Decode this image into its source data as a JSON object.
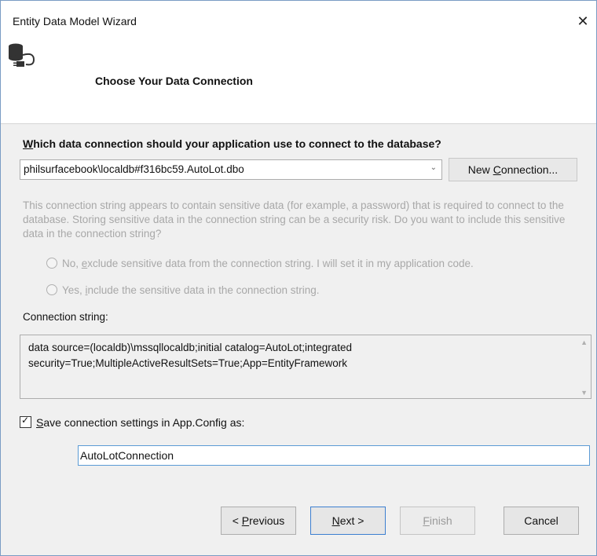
{
  "window": {
    "title": "Entity Data Model Wizard",
    "close_glyph": "✕"
  },
  "header": {
    "heading": "Choose Your Data Connection",
    "icon": "database-connection-icon"
  },
  "question": {
    "prefix": "W",
    "rest": "hich data connection should your application use to connect to the database?"
  },
  "connection": {
    "selected": "philsurfacebook\\localdb#f316bc59.AutoLot.dbo",
    "chevron": "⌄",
    "new_button_prefix": "New ",
    "new_button_access": "C",
    "new_button_rest": "onnection..."
  },
  "sensitive": {
    "description": "This connection string appears to contain sensitive data (for example, a password) that is required to connect to the database. Storing sensitive data in the connection string can be a security risk. Do you want to include this sensitive data in the connection string?",
    "option_no_prefix": "No, ",
    "option_no_access": "e",
    "option_no_rest": "xclude sensitive data from the connection string. I will set it in my application code.",
    "option_yes_prefix": "Yes, ",
    "option_yes_access": "i",
    "option_yes_rest": "nclude the sensitive data in the connection string."
  },
  "connection_string": {
    "label": "Connection string:",
    "value": "data source=(localdb)\\mssqllocaldb;initial catalog=AutoLot;integrated security=True;MultipleActiveResultSets=True;App=EntityFramework",
    "scroll_up": "▲",
    "scroll_down": "▼"
  },
  "save": {
    "checked": true,
    "check_glyph": "✓",
    "label_access": "S",
    "label_rest": "ave connection settings in App.Config as:",
    "config_name": "AutoLotConnection"
  },
  "buttons": {
    "prev_prefix": "< ",
    "prev_access": "P",
    "prev_rest": "revious",
    "next_access": "N",
    "next_rest": "ext >",
    "finish_access": "F",
    "finish_rest": "inish",
    "cancel": "Cancel"
  }
}
